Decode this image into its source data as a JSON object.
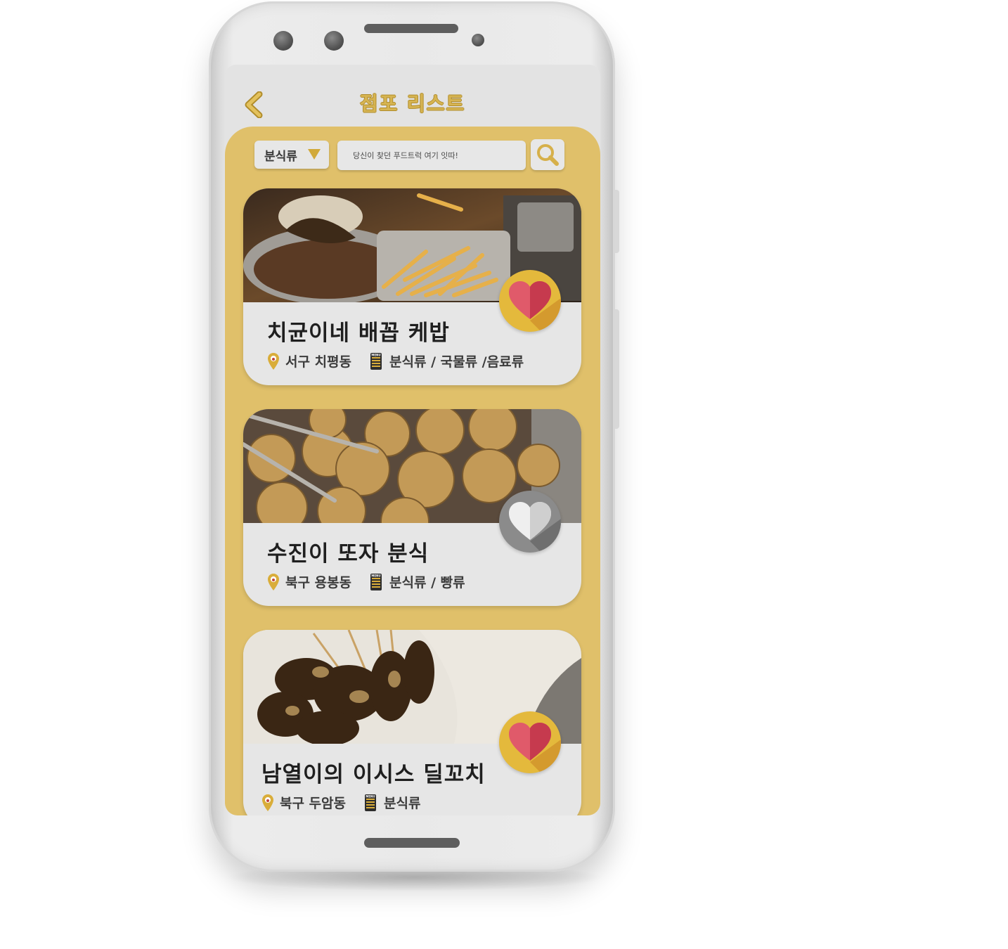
{
  "header": {
    "title": "점포 리스트",
    "back_icon": "chevron-left-icon"
  },
  "search": {
    "category_selected": "분식류",
    "placeholder": "당신이 찾던 푸드트럭 여기 잇따!",
    "search_icon": "magnifier-icon"
  },
  "stores": [
    {
      "name": "치균이네 배꼽 케밥",
      "location": "서구 치평동",
      "categories": "분식류 / 국물류 /음료류",
      "favorited": true
    },
    {
      "name": "수진이 또자 분식",
      "location": "북구 용봉동",
      "categories": "분식류 / 빵류",
      "favorited": false
    },
    {
      "name": "남열이의 이시스 딜꼬치",
      "location": "북구 두암동",
      "categories": "분식류",
      "favorited": true
    }
  ],
  "icons": {
    "location": "map-pin-icon",
    "menu": "menu-book-icon",
    "favorite": "heart-icon"
  },
  "colors": {
    "accent": "#e0c06a",
    "title_gold": "#d6b452",
    "heart_pink": "#e05a6a",
    "fav_on": "#e4b93c",
    "fav_off": "#8b8b8b",
    "screen_bg": "#e3e3e3"
  },
  "menu_icon_text": "MENU"
}
